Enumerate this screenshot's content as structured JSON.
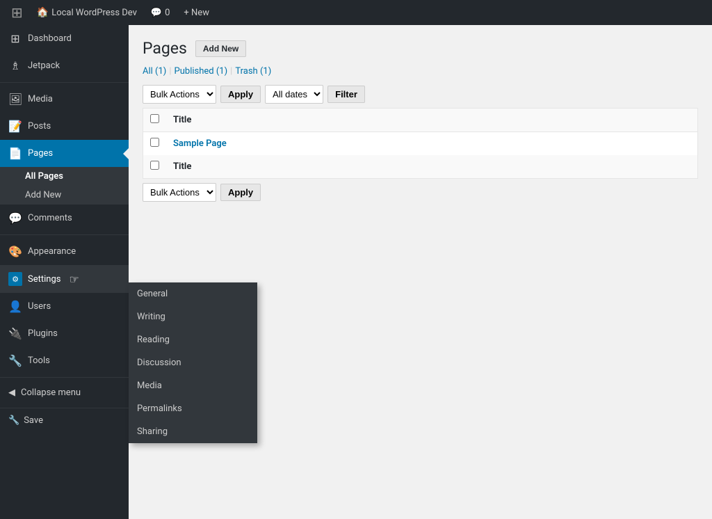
{
  "adminbar": {
    "logo": "⊞",
    "site_name": "Local WordPress Dev",
    "comments_icon": "💬",
    "comments_count": "0",
    "new_label": "+ New"
  },
  "sidebar": {
    "items": [
      {
        "id": "dashboard",
        "label": "Dashboard",
        "icon": "⊞"
      },
      {
        "id": "jetpack",
        "label": "Jetpack",
        "icon": "♗"
      },
      {
        "id": "media",
        "label": "Media",
        "icon": "🖼"
      },
      {
        "id": "posts",
        "label": "Posts",
        "icon": "📝"
      },
      {
        "id": "pages",
        "label": "Pages",
        "icon": "📄",
        "active": true
      },
      {
        "id": "comments",
        "label": "Comments",
        "icon": "💬"
      },
      {
        "id": "appearance",
        "label": "Appearance",
        "icon": "🎨"
      },
      {
        "id": "settings",
        "label": "Settings",
        "icon": "⚙",
        "settings_active": true
      },
      {
        "id": "users",
        "label": "Users",
        "icon": "👤"
      },
      {
        "id": "plugins",
        "label": "Plugins",
        "icon": "🔌"
      },
      {
        "id": "tools",
        "label": "Tools",
        "icon": "🔧"
      }
    ],
    "pages_submenu": [
      {
        "id": "all-pages",
        "label": "All Pages",
        "active": true
      },
      {
        "id": "add-new",
        "label": "Add New",
        "active": false
      }
    ],
    "collapse_label": "Collapse menu",
    "save_label": "Save"
  },
  "main": {
    "title": "Pages",
    "add_new_label": "Add New",
    "filters": {
      "all_label": "All",
      "all_count": "(1)",
      "published_label": "Published",
      "published_count": "(1)",
      "trash_label": "Trash",
      "trash_count": "(1)"
    },
    "top_tablenav": {
      "bulk_actions_label": "Bulk Actions",
      "apply_label": "Apply",
      "all_dates_label": "All dates",
      "filter_label": "Filter"
    },
    "table": {
      "title_header": "Title",
      "rows": [
        {
          "title": "Sample Page",
          "link": true
        }
      ]
    },
    "bottom_tablenav": {
      "bulk_actions_label": "Bulk Actions",
      "apply_label": "Apply"
    }
  },
  "settings_dropdown": {
    "items": [
      {
        "id": "general",
        "label": "General"
      },
      {
        "id": "writing",
        "label": "Writing"
      },
      {
        "id": "reading",
        "label": "Reading"
      },
      {
        "id": "discussion",
        "label": "Discussion"
      },
      {
        "id": "media",
        "label": "Media"
      },
      {
        "id": "permalinks",
        "label": "Permalinks"
      },
      {
        "id": "sharing",
        "label": "Sharing"
      }
    ]
  }
}
